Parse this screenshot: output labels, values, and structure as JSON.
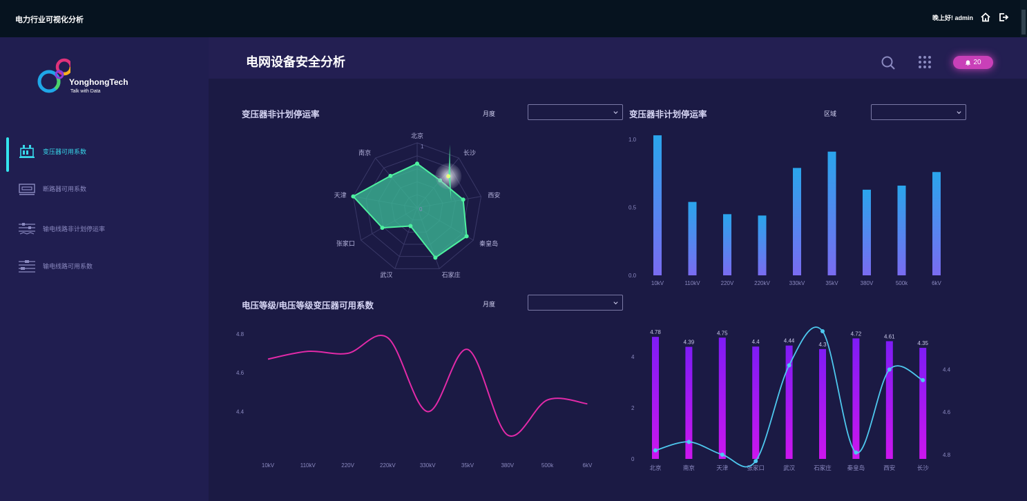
{
  "topbar": {
    "app_title": "电力行业可视化分析",
    "greeting": "晚上好! admin",
    "home_icon": "home-icon",
    "logout_icon": "logout-icon"
  },
  "logo": {
    "brand": "YonghongTech",
    "slogan": "Talk with Data"
  },
  "sidebar": {
    "items": [
      {
        "label": "变压器可用系数",
        "icon": "transformer-icon",
        "active": true
      },
      {
        "label": "断路器可用系数",
        "icon": "breaker-icon",
        "active": false
      },
      {
        "label": "输电线路非计划停运率",
        "icon": "transmission-line-icon",
        "active": false
      },
      {
        "label": "输电线路可用系数",
        "icon": "transmission-availability-icon",
        "active": false
      }
    ]
  },
  "header": {
    "title": "电网设备安全分析",
    "search_icon": "search-icon",
    "apps_icon": "grid-apps-icon",
    "notification_count": "20"
  },
  "colors": {
    "accent": "#34e3ee",
    "radar_fill": "#3bb895",
    "radar_line": "#4ef1a0",
    "bar_top": "#2aa5ec",
    "bar_bottom": "#7a6cf1",
    "line_pink": "#e22aa8",
    "combo_bar": "#b21ef7",
    "combo_line": "#4ec8ee"
  },
  "panels": {
    "radar": {
      "title": "变压器非计划停运率",
      "filter_label": "月度",
      "filter_value": ""
    },
    "bar": {
      "title": "变压器非计划停运率",
      "filter_label": "区域",
      "filter_value": ""
    },
    "line": {
      "title": "电压等级/电压等级变压器可用系数",
      "filter_label": "月度",
      "filter_value": ""
    }
  },
  "chart_data": [
    {
      "type": "radar",
      "categories": [
        "北京",
        "长沙",
        "西安",
        "秦皇岛",
        "石家庄",
        "武汉",
        "张家口",
        "天津",
        "南京"
      ],
      "values": [
        0.68,
        0.55,
        0.72,
        0.88,
        0.82,
        0.3,
        0.62,
        1.0,
        0.64
      ],
      "scale_labels": [
        "1",
        "0"
      ],
      "max": 1,
      "highlight_index": 1
    },
    {
      "type": "bar",
      "categories": [
        "10kV",
        "110kV",
        "220V",
        "220kV",
        "330kV",
        "35kV",
        "380V",
        "500k",
        "6kV"
      ],
      "values": [
        1.03,
        0.54,
        0.45,
        0.44,
        0.79,
        0.91,
        0.63,
        0.66,
        0.76
      ],
      "yticks": [
        "1.0",
        "0.5",
        "0.0"
      ],
      "ylim": [
        0,
        1.0
      ]
    },
    {
      "type": "line",
      "categories": [
        "10kV",
        "110kV",
        "220V",
        "220kV",
        "330kV",
        "35kV",
        "380V",
        "500k",
        "6kV"
      ],
      "values": [
        4.67,
        4.71,
        4.7,
        4.78,
        4.4,
        4.72,
        4.28,
        4.46,
        4.44
      ],
      "yticks": [
        "4.8",
        "4.6",
        "4.4"
      ],
      "ylim": [
        4.21,
        4.81
      ]
    },
    {
      "type": "bar",
      "categories": [
        "北京",
        "南京",
        "天津",
        "张家口",
        "武汉",
        "石家庄",
        "秦皇岛",
        "西安",
        "长沙"
      ],
      "series": [
        {
          "type": "bar",
          "values": [
            4.78,
            4.39,
            4.75,
            4.4,
            4.44,
            4.3,
            4.72,
            4.61,
            4.35
          ],
          "labels": [
            "4.78",
            "4.39",
            "4.75",
            "4.4",
            "4.44",
            "4.3",
            "4.72",
            "4.61",
            "4.35"
          ]
        },
        {
          "type": "line",
          "values": [
            4.78,
            4.74,
            4.8,
            4.83,
            4.38,
            4.22,
            4.79,
            4.4,
            4.45
          ]
        }
      ],
      "yticks_left": [
        "4",
        "2",
        "0"
      ],
      "ylim_left": [
        0,
        5
      ],
      "yticks_right": [
        "4.4",
        "4.6",
        "4.8"
      ],
      "ylim_right_inverted": [
        4.22,
        4.82
      ]
    }
  ]
}
